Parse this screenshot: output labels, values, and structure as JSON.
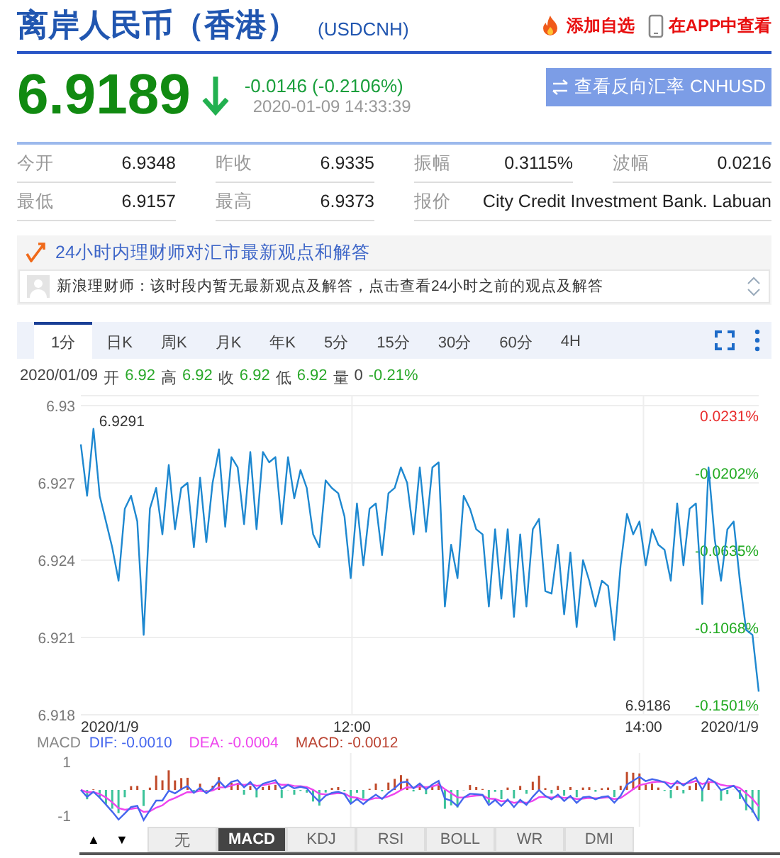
{
  "header": {
    "title": "离岸人民币（香港）",
    "symbol": "(USDCNH)",
    "actions": [
      {
        "kind": "fire",
        "label": "添加自选"
      },
      {
        "kind": "phone",
        "label": "在APP中查看"
      }
    ]
  },
  "quote": {
    "price": "6.9189",
    "change": "-0.0146 (-0.2106%)",
    "time": "2020-01-09 14:33:39",
    "reverse_button": "查看反向汇率 CNHUSD"
  },
  "stats": [
    [
      {
        "label": "今开",
        "value": "6.9348"
      },
      {
        "label": "昨收",
        "value": "6.9335"
      },
      {
        "label": "振幅",
        "value": "0.3115%"
      },
      {
        "label": "波幅",
        "value": "0.0216"
      }
    ],
    [
      {
        "label": "最低",
        "value": "6.9157"
      },
      {
        "label": "最高",
        "value": "6.9373"
      },
      {
        "label": "报价",
        "value": "City Credit Investment Bank. Labuan"
      }
    ]
  ],
  "advice": {
    "title": "24小时内理财师对汇市最新观点和解答",
    "message": "新浪理财师：该时段内暂无最新观点及解答，点击查看24小时之前的观点及解答"
  },
  "period_tabs": [
    {
      "label": "1分",
      "selected": true
    },
    {
      "label": "日K",
      "selected": false
    },
    {
      "label": "周K",
      "selected": false
    },
    {
      "label": "月K",
      "selected": false
    },
    {
      "label": "年K",
      "selected": false
    },
    {
      "label": "5分",
      "selected": false
    },
    {
      "label": "15分",
      "selected": false
    },
    {
      "label": "30分",
      "selected": false
    },
    {
      "label": "60分",
      "selected": false
    },
    {
      "label": "4H",
      "selected": false
    }
  ],
  "ohlc": {
    "date": "2020/01/09",
    "items": [
      {
        "label": "开",
        "value": "6.92"
      },
      {
        "label": "高",
        "value": "6.92"
      },
      {
        "label": "收",
        "value": "6.92"
      },
      {
        "label": "低",
        "value": "6.92"
      },
      {
        "label": "量",
        "value": "0",
        "kind": "volume"
      }
    ],
    "change": "-0.21%"
  },
  "chart": {
    "chart_data": {
      "type": "line",
      "grid": true,
      "yticks": [
        6.918,
        6.921,
        6.924,
        6.927,
        6.93
      ],
      "ylim": [
        6.918,
        6.93
      ],
      "series": [
        {
          "color": "#1e88d0",
          "values": [
            6.9285,
            6.9265,
            6.9291,
            6.9265,
            6.9255,
            6.9245,
            6.9232,
            6.926,
            6.9265,
            6.9255,
            6.9211,
            6.926,
            6.9268,
            6.925,
            6.9277,
            6.9252,
            6.9268,
            6.927,
            6.9245,
            6.9272,
            6.9247,
            6.927,
            6.9283,
            6.9253,
            6.928,
            6.9276,
            6.9254,
            6.9282,
            6.9252,
            6.9282,
            6.9278,
            6.928,
            6.9254,
            6.928,
            6.9264,
            6.9275,
            6.9268,
            6.925,
            6.9245,
            6.9271,
            6.9268,
            6.9266,
            6.9257,
            6.9233,
            6.9262,
            6.9238,
            6.926,
            6.9262,
            6.9242,
            6.9266,
            6.9268,
            6.9276,
            6.927,
            6.925,
            6.9276,
            6.9251,
            6.9276,
            6.9278,
            6.9222,
            6.9246,
            6.9233,
            6.9265,
            6.926,
            6.9252,
            6.925,
            6.9222,
            6.9252,
            6.9225,
            6.9252,
            6.9218,
            6.925,
            6.9222,
            6.9252,
            6.9256,
            6.9228,
            6.9227,
            6.9246,
            6.9219,
            6.9243,
            6.9214,
            6.924,
            6.9232,
            6.9222,
            6.9232,
            6.923,
            6.9209,
            6.9238,
            6.9258,
            6.925,
            6.9255,
            6.9238,
            6.9252,
            6.9246,
            6.9244,
            6.9232,
            6.9262,
            6.9238,
            6.926,
            6.9262,
            6.9223,
            6.9276,
            6.9248,
            6.9232,
            6.9252,
            6.9255,
            6.9232,
            6.9213,
            6.9211,
            6.9189
          ]
        }
      ]
    },
    "x_labels": [
      "2020/1/9",
      "12:00",
      "14:00",
      "2020/1/9"
    ],
    "max_label": "6.9291",
    "last_label": "6.9186",
    "right_labels": [
      {
        "label": "0.0231%",
        "kind": "up"
      },
      {
        "label": "-0.0202%",
        "kind": "down"
      },
      {
        "label": "-0.0635%",
        "kind": "down"
      },
      {
        "label": "-0.1068%",
        "kind": "down"
      },
      {
        "label": "-0.1501%",
        "kind": "down"
      }
    ]
  },
  "macd": {
    "name": "MACD",
    "legend": [
      {
        "label": "DIF: -0.0010",
        "color": "#4466ee"
      },
      {
        "label": "DEA: -0.0004",
        "color": "#ee44ee"
      },
      {
        "label": "MACD: -0.0012",
        "color": "#bb4433"
      }
    ],
    "ticks": [
      "1",
      "-1"
    ]
  },
  "indicator_nav": [
    "▲",
    "▼"
  ],
  "indicator_tabs": [
    {
      "label": "无",
      "selected": false
    },
    {
      "label": "MACD",
      "selected": true
    },
    {
      "label": "KDJ",
      "selected": false
    },
    {
      "label": "RSI",
      "selected": false
    },
    {
      "label": "BOLL",
      "selected": false
    },
    {
      "label": "WR",
      "selected": false
    },
    {
      "label": "DMI",
      "selected": false
    }
  ]
}
